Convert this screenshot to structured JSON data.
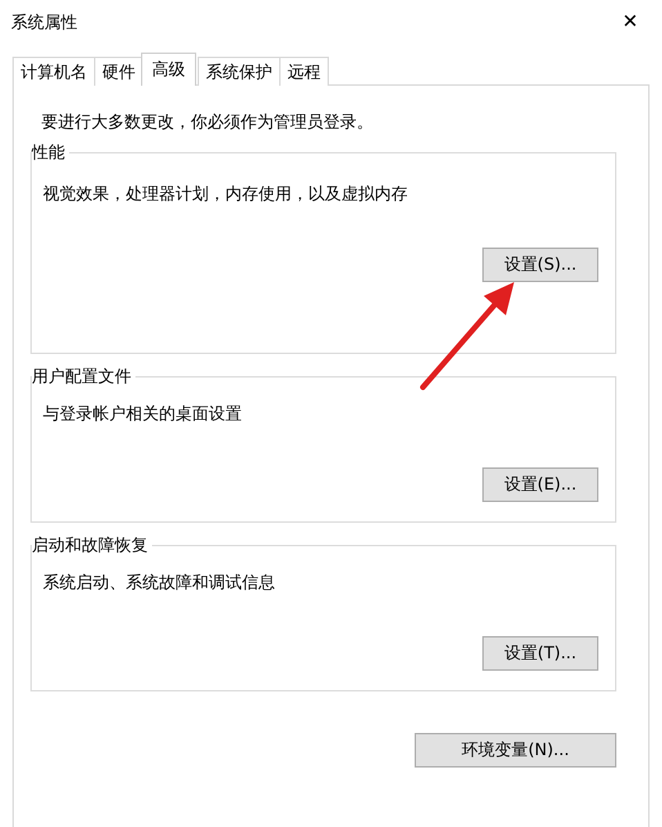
{
  "window": {
    "title": "系统属性",
    "close": "✕"
  },
  "tabs": [
    {
      "label": "计算机名",
      "selected": false
    },
    {
      "label": "硬件",
      "selected": false
    },
    {
      "label": "高级",
      "selected": true
    },
    {
      "label": "系统保护",
      "selected": false
    },
    {
      "label": "远程",
      "selected": false
    }
  ],
  "notice": "要进行大多数更改，你必须作为管理员登录。",
  "groups": [
    {
      "title": "性能",
      "description": "视觉效果，处理器计划，内存使用，以及虚拟内存",
      "button": "设置(S)..."
    },
    {
      "title": "用户配置文件",
      "description": "与登录帐户相关的桌面设置",
      "button": "设置(E)..."
    },
    {
      "title": "启动和故障恢复",
      "description": "系统启动、系统故障和调试信息",
      "button": "设置(T)..."
    }
  ],
  "env_button": "环境变量(N)...",
  "annotation": {
    "kind": "arrow"
  }
}
